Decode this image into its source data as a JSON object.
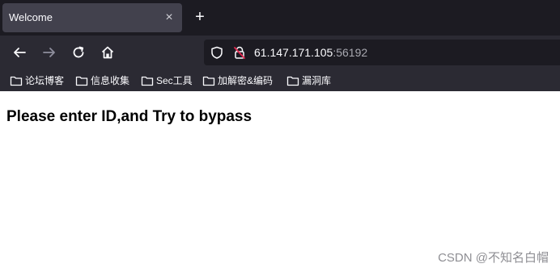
{
  "tab": {
    "title": "Welcome",
    "close_glyph": "×",
    "new_tab_glyph": "+"
  },
  "nav": {
    "back_icon": "arrow-left-icon",
    "forward_icon": "arrow-right-icon",
    "reload_icon": "reload-icon",
    "home_icon": "home-icon"
  },
  "url": {
    "host": "61.147.171.105",
    "port": ":56192",
    "shield_icon": "shield-icon",
    "lock_icon": "insecure-lock-icon"
  },
  "bookmarks": [
    {
      "label": "论坛博客"
    },
    {
      "label": "信息收集"
    },
    {
      "label": "Sec工具"
    },
    {
      "label": "加解密&编码"
    },
    {
      "label": "漏洞库"
    }
  ],
  "page": {
    "heading": "Please enter ID,and Try to bypass"
  },
  "watermark": "CSDN @不知名白帽",
  "colors": {
    "tabbar_bg": "#1c1b22",
    "toolbar_bg": "#2b2a33",
    "active_tab_bg": "#42414d",
    "text_light": "#fbfbfe",
    "insecure_red": "#e22850"
  }
}
